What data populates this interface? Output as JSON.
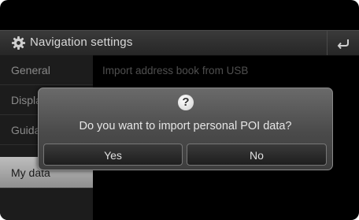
{
  "header": {
    "title": "Navigation settings",
    "icon": "gear-icon",
    "back_icon": "back-arrow-icon"
  },
  "sidebar": {
    "items": [
      {
        "label": "General",
        "active": false
      },
      {
        "label": "Display",
        "active": false
      },
      {
        "label": "Guidance",
        "active": false
      },
      {
        "label": "My data",
        "active": true
      }
    ]
  },
  "content": {
    "item": "Import address book from USB"
  },
  "dialog": {
    "icon": "question-icon",
    "icon_text": "?",
    "message": "Do you want to import personal POI data?",
    "yes_label": "Yes",
    "no_label": "No"
  },
  "colors": {
    "screen_bg": "#000000",
    "active_item_bg": "#a8a8a8",
    "dialog_bg": "#555555"
  }
}
